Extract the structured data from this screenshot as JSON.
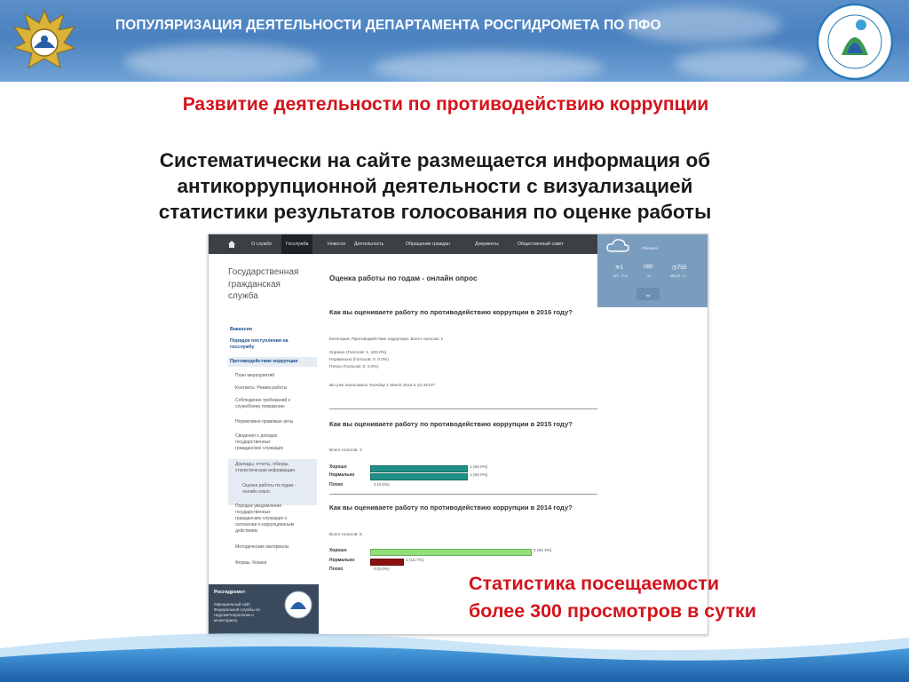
{
  "header": {
    "title": "ПОПУЛЯРИЗАЦИЯ ДЕЯТЕЛЬНОСТИ ДЕПАРТАМЕНТА РОСГИДРОМЕТА ПО ПФО"
  },
  "slide": {
    "heading": "Развитие деятельности по противодействию коррупции",
    "intro_lines": [
      "Систематически на сайте  размещается информация об",
      "антикоррупционной деятельности с визуализацией",
      "статистики результатов голосования по оценке работы"
    ],
    "stats_lines": [
      "Статистика посещаемости",
      "более 300 просмотров в сутки"
    ]
  },
  "colors": {
    "header_blue": "#4a81bf",
    "heading_red": "#d4141c",
    "bar_teal": "#1f9187",
    "bar_green": "#92e07c",
    "bar_darkred": "#8a1010"
  },
  "screenshot": {
    "nav": [
      "О службе",
      "Госслужба",
      "Новости",
      "Деятельность",
      "Обращение граждан",
      "Документы",
      "Общественный совет"
    ],
    "weather": {
      "condition": "Облачно",
      "wind": "1",
      "wind_sub": "юб. ↓0.3",
      "humidity": "80",
      "humidity_sub": "%",
      "pressure": "755",
      "pressure_sub": "мм рт. ст."
    },
    "sidebar": {
      "title_lines": [
        "Государственная",
        "гражданская",
        "служба"
      ],
      "links": [
        "Вакансии",
        "Порядок поступления на",
        "госслужбу",
        "Противодействие коррупции"
      ],
      "subitems": [
        "План мероприятий",
        "Контакты. Режим работы",
        "Соблюдение требований к",
        "служебному поведению",
        "Нормативно-правовые акты",
        "Сведения о доходах",
        "государственных",
        "гражданских служащих",
        "Доклады, отчеты, обзоры,",
        "статистическая информация",
        "Оценка работы по годам -",
        "онлайн опрос",
        "Порядок уведомления",
        "государственных",
        "гражданских служащих о",
        "склонении к коррупционным",
        "действиям",
        "Методические материалы",
        "Формы, бланки"
      ],
      "footer_title": "Росгидромет",
      "footer_text": "Официальный сайт Федеральной службы по гидрометеорологии и мониторингу"
    },
    "main": {
      "title": "Оценка работы по годам - онлайн опрос",
      "poll2016": {
        "question": "Как вы оцениваете работу по противодействию коррупции в 2016 году?",
        "category": "Категория: Противодействие коррупции. Всего голосов: 1",
        "results": [
          "Хорошо (Голосов: 1, 100.0%)",
          "Нормально (Голосов: 0, 0.0%)",
          "Плохо (Голосов: 0, 0.0%)"
        ],
        "voted": "Вы уже голосовали Tuesday 1 March 2016 в 12:44:07!"
      },
      "poll2015": {
        "question": "Как вы оцениваете работу по противодействию коррупции в 2015 году?",
        "total": "Всего голосов: 2",
        "rows": [
          {
            "label": "Хорошо",
            "value": "1 (50.0%)",
            "share": 0.5
          },
          {
            "label": "Нормально",
            "value": "1 (50.0%)",
            "share": 0.5
          },
          {
            "label": "Плохо",
            "value": "0 (0.0%)",
            "share": 0
          }
        ]
      },
      "poll2014": {
        "question": "Как вы оцениваете работу по противодействию коррупции в 2014 году?",
        "total": "Всего голосов: 6",
        "rows": [
          {
            "label": "Хорошо",
            "value": "5 (83.3%)",
            "share": 0.833
          },
          {
            "label": "Нормально",
            "value": "1 (16.7%)",
            "share": 0.167
          },
          {
            "label": "Плохо",
            "value": "0 (0.0%)",
            "share": 0
          }
        ]
      }
    }
  }
}
